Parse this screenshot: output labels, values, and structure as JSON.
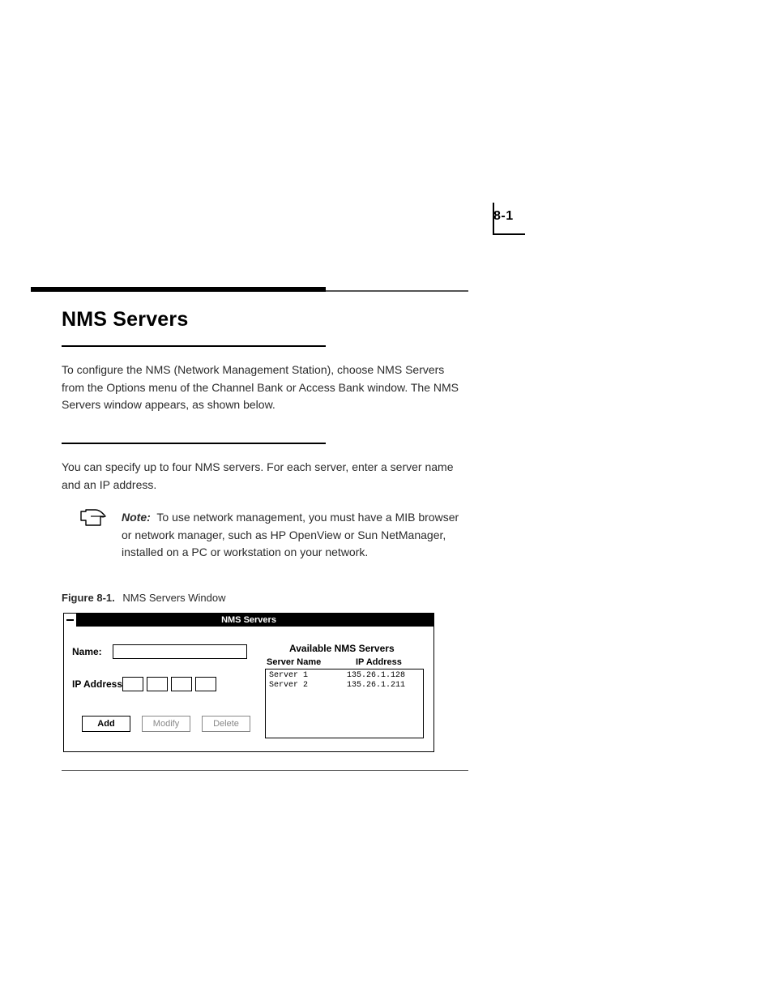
{
  "page_number": "8-1",
  "section_title": "NMS Servers",
  "para1": "To configure the NMS (Network Management Station), choose NMS Servers from the Options menu of the Channel Bank or Access Bank window. The NMS Servers window appears, as shown below.",
  "para2": "You can specify up to four NMS servers. For each server, enter a server name and an IP address.",
  "note_label": "Note:",
  "note_text": "To use network management, you must have a MIB browser or network manager, such as HP OpenView or Sun NetManager, installed on a PC or workstation on your network.",
  "figure_label": "Figure 8-1.",
  "figure_title": "NMS Servers Window",
  "dialog": {
    "title": "NMS Servers",
    "name_label": "Name:",
    "ip_label": "IP Address:",
    "buttons": {
      "add": "Add",
      "modify": "Modify",
      "delete": "Delete"
    },
    "available_title": "Available NMS Servers",
    "col_server": "Server Name",
    "col_ip": "IP Address",
    "rows": [
      {
        "name": "Server 1",
        "ip": "135.26.1.128"
      },
      {
        "name": "Server 2",
        "ip": "135.26.1.211"
      }
    ]
  }
}
